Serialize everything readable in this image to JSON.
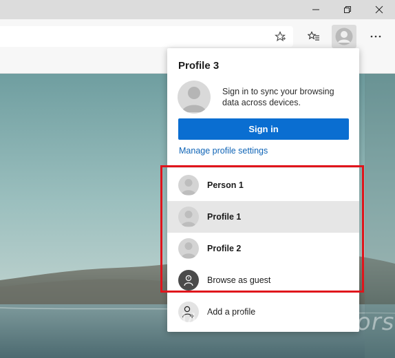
{
  "window_controls": {
    "minimize_icon": "minimize-icon",
    "restore_icon": "restore-icon",
    "close_icon": "close-icon"
  },
  "toolbar": {
    "favorite_icon": "star-icon",
    "favorites_icon": "favorites-icon",
    "profile_icon": "profile-icon",
    "more_icon": "more-icon"
  },
  "flyout": {
    "title": "Profile 3",
    "sync_text": "Sign in to sync your browsing data across devices.",
    "signin_label": "Sign in",
    "manage_link": "Manage profile settings",
    "profiles": [
      {
        "label": "Person 1"
      },
      {
        "label": "Profile 1"
      },
      {
        "label": "Profile 2"
      }
    ],
    "guest_label": "Browse as guest",
    "add_profile_label": "Add a profile"
  },
  "watermark": "Windowsfixerrors.com",
  "colors": {
    "accent": "#0a6ed1",
    "link": "#0f64b6",
    "highlight_border": "#e0141b",
    "hover_row": "#e6e6e6"
  }
}
